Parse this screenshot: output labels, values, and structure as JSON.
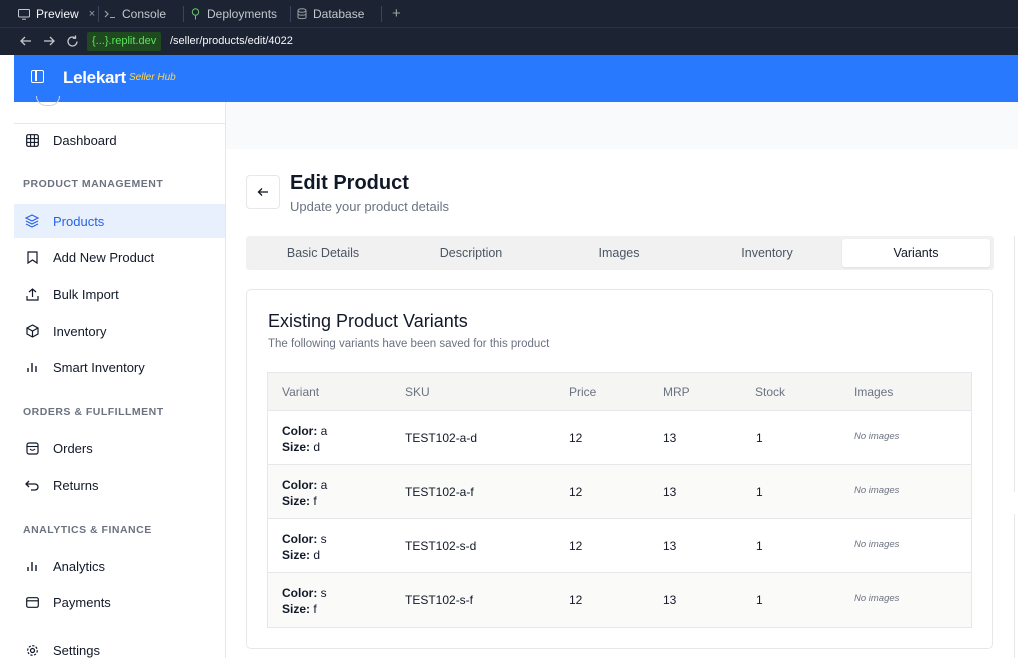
{
  "ide": {
    "tabs": [
      {
        "label": "Preview",
        "icon": "monitor-icon",
        "active": true
      },
      {
        "label": "Console",
        "icon": "terminal-icon",
        "active": false
      },
      {
        "label": "Deployments",
        "icon": "deployments-icon",
        "active": false
      },
      {
        "label": "Database",
        "icon": "database-icon",
        "active": false
      }
    ],
    "close_glyph": "×",
    "add_glyph": "+",
    "domain": "{...}.replit.dev",
    "path": "/seller/products/edit/4022"
  },
  "header": {
    "brand": "Lelekart",
    "brand_sub": "Seller Hub",
    "brand_color": "#2979ff"
  },
  "sidebar": {
    "sections": {
      "product_management": "PRODUCT MANAGEMENT",
      "orders_fulfillment": "ORDERS & FULFILLMENT",
      "analytics_finance": "ANALYTICS & FINANCE"
    },
    "items": [
      {
        "label": "Dashboard",
        "icon": "grid-icon"
      },
      {
        "label": "Products",
        "icon": "layers-icon",
        "active": true
      },
      {
        "label": "Add New Product",
        "icon": "bookmark-icon"
      },
      {
        "label": "Bulk Import",
        "icon": "upload-icon"
      },
      {
        "label": "Inventory",
        "icon": "box-icon"
      },
      {
        "label": "Smart Inventory",
        "icon": "bar-chart-icon"
      },
      {
        "label": "Orders",
        "icon": "inbox-icon"
      },
      {
        "label": "Returns",
        "icon": "return-icon"
      },
      {
        "label": "Analytics",
        "icon": "bar-chart-icon"
      },
      {
        "label": "Payments",
        "icon": "wallet-icon"
      },
      {
        "label": "Settings",
        "icon": "gear-icon"
      }
    ]
  },
  "page": {
    "title": "Edit Product",
    "subtitle": "Update your product details",
    "tabs": [
      {
        "label": "Basic Details"
      },
      {
        "label": "Description"
      },
      {
        "label": "Images"
      },
      {
        "label": "Inventory"
      },
      {
        "label": "Variants",
        "active": true
      }
    ]
  },
  "variants_card": {
    "title": "Existing Product Variants",
    "subtitle": "The following variants have been saved for this product",
    "columns": [
      "Variant",
      "SKU",
      "Price",
      "MRP",
      "Stock",
      "Images"
    ],
    "color_label": "Color:",
    "size_label": "Size:",
    "rows": [
      {
        "color": "a",
        "size": "d",
        "sku": "TEST102-a-d",
        "price": "12",
        "mrp": "13",
        "stock": "1",
        "images": "No images"
      },
      {
        "color": "a",
        "size": "f",
        "sku": "TEST102-a-f",
        "price": "12",
        "mrp": "13",
        "stock": "1",
        "images": "No images"
      },
      {
        "color": "s",
        "size": "d",
        "sku": "TEST102-s-d",
        "price": "12",
        "mrp": "13",
        "stock": "1",
        "images": "No images"
      },
      {
        "color": "s",
        "size": "f",
        "sku": "TEST102-s-f",
        "price": "12",
        "mrp": "13",
        "stock": "1",
        "images": "No images"
      }
    ]
  }
}
